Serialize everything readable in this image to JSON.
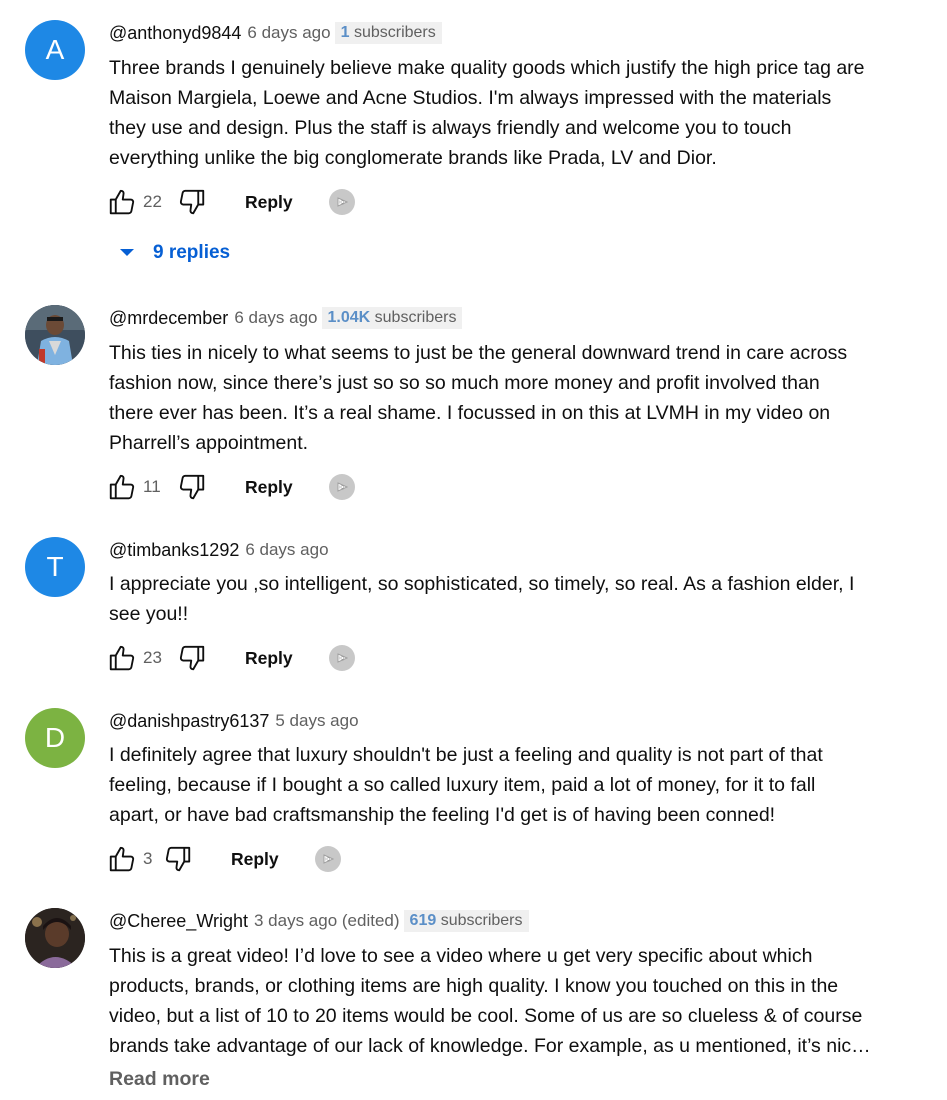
{
  "comments": [
    {
      "author": "@anthonyd9844",
      "time": "6 days ago",
      "subs_value": "1",
      "subs_label": "subscribers",
      "avatar_letter": "A",
      "avatar_color": "#1e88e5",
      "lines": [
        "Three brands I genuinely believe make quality goods which justify the high price tag are",
        "Maison Margiela, Loewe and Acne Studios. I'm always impressed with the materials",
        "they use and design. Plus the staff is always friendly and welcome you to touch",
        "everything unlike the big conglomerate brands like Prada, LV and Dior."
      ],
      "likes": "22",
      "reply_label": "Reply",
      "replies_label": "9 replies"
    },
    {
      "author": "@mrdecember",
      "time": "6 days ago",
      "subs_value": "1.04K",
      "subs_label": "subscribers",
      "lines": [
        "This ties in nicely to what seems to just be the general downward trend in care across",
        "fashion now, since there’s just so so so much more money and profit involved than",
        "there ever has been. It’s a real shame. I focussed in on this at LVMH in my video on",
        "Pharrell’s appointment."
      ],
      "likes": "11",
      "reply_label": "Reply"
    },
    {
      "author": "@timbanks1292",
      "time": "6 days ago",
      "avatar_letter": "T",
      "avatar_color": "#1e88e5",
      "lines": [
        "I appreciate you ,so intelligent, so sophisticated, so timely,  so real. As a fashion elder, I",
        "see you!!"
      ],
      "likes": "23",
      "reply_label": "Reply"
    },
    {
      "author": "@danishpastry6137",
      "time": "5 days ago",
      "avatar_letter": "D",
      "avatar_color": "#7cb342",
      "lines": [
        "I definitely agree that luxury shouldn't be just a feeling and quality is not part of that",
        "feeling, because if I bought a so called luxury item, paid a lot of money, for it to fall",
        "apart, or have bad craftsmanship the feeling I'd get is of having been conned!"
      ],
      "likes": "3",
      "reply_label": "Reply"
    },
    {
      "author": "@Cheree_Wright",
      "time": "3 days ago (edited)",
      "subs_value": "619",
      "subs_label": "subscribers",
      "lines": [
        "This is a great video! I’d love to see a video where u get very specific about which",
        "products, brands, or clothing items are high quality. I know you touched on this in the",
        "video, but a list of 10 to 20 items would be cool. Some of us are so clueless & of course",
        "brands take advantage of our lack of knowledge. For example, as u mentioned, it’s nic…"
      ],
      "read_more": "Read more"
    }
  ],
  "icons": {
    "like": "thumbs-up-icon",
    "dislike": "thumbs-down-icon",
    "badge": "iq-badge-icon",
    "expand": "caret-down-icon"
  }
}
